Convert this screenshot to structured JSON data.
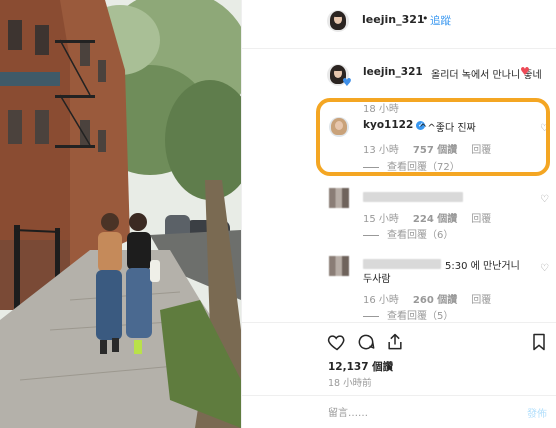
{
  "header": {
    "username": "leejin_321",
    "dot": "•",
    "follow_label": "追蹤"
  },
  "caption": {
    "username": "leejin_321",
    "text": "올리더 녹에서 만나니 좋네",
    "emoji_hearts": [
      "red-heart",
      "blue-heart"
    ],
    "time": "18 小時"
  },
  "comments": [
    {
      "username": "kyo1122",
      "verified": true,
      "text": "^^좋다 진짜",
      "time": "13 小時",
      "likes": "757 個讚",
      "reply_label": "回覆",
      "view_replies": "查看回覆（72）"
    },
    {
      "username_hidden": true,
      "text_hidden": true,
      "time": "15 小時",
      "likes": "224 個讚",
      "reply_label": "回覆",
      "view_replies": "查看回覆（6）"
    },
    {
      "username_hidden": true,
      "text_visible": "5:30 에 만난거니",
      "text_line2": "두사람",
      "time": "16 小時",
      "likes": "260 個讚",
      "reply_label": "回覆",
      "view_replies": "查看回覆（5）"
    }
  ],
  "actions": {
    "icons": [
      "heart-icon",
      "comment-icon",
      "share-icon",
      "bookmark-icon"
    ],
    "likes_count": "12,137 個讚",
    "post_time": "18 小時前"
  },
  "add_comment": {
    "placeholder": "留言……",
    "post_label": "發佈"
  },
  "colors": {
    "link_blue": "#3897f0",
    "highlight_orange": "#f4a623",
    "heart_red": "#ed4956",
    "heart_blue": "#3f8fe8",
    "muted_gray": "#999999"
  }
}
